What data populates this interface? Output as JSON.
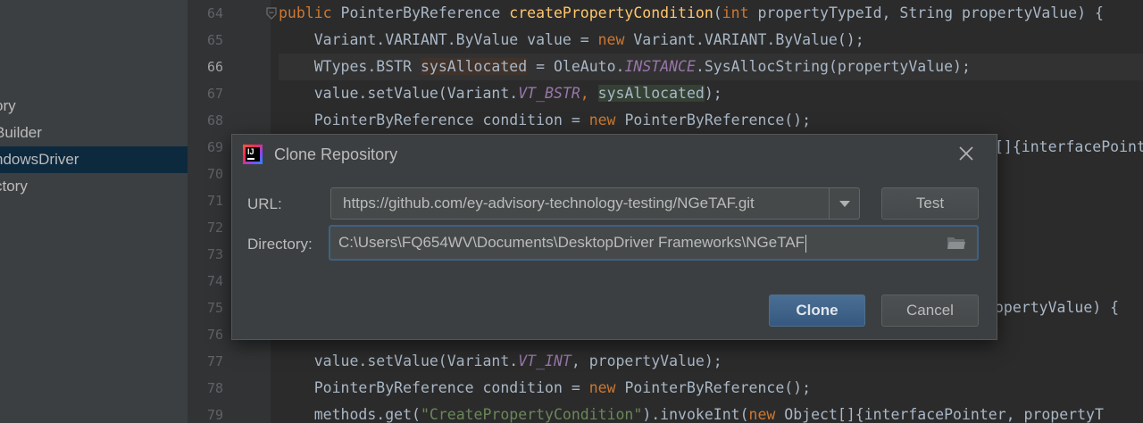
{
  "sidebar": {
    "items": [
      {
        "label": "ory",
        "selected": false
      },
      {
        "label": "Builder",
        "selected": false
      },
      {
        "label": "ndowsDriver",
        "selected": true
      },
      {
        "label": "ctory",
        "selected": false
      }
    ]
  },
  "editor": {
    "line_numbers": [
      "64",
      "65",
      "66",
      "67",
      "68",
      "69",
      "70",
      "71",
      "72",
      "73",
      "74",
      "75",
      "76",
      "77",
      "78",
      "79"
    ],
    "current_line": "66",
    "lines": {
      "l64": {
        "a": "public ",
        "b": "PointerByReference ",
        "c": "createPropertyCondition",
        "d": "(",
        "e": "int ",
        "f": "propertyTypeId, String propertyValue) {"
      },
      "l65": {
        "a": "    Variant.VARIANT.ByValue value = ",
        "b": "new ",
        "c": "Variant.VARIANT.ByValue();"
      },
      "l66": {
        "a": "    WTypes.BSTR ",
        "b": "sysAllocated",
        "c": " = OleAuto.",
        "d": "INSTANCE",
        "e": ".SysAllocString(propertyValue);"
      },
      "l67": {
        "a": "    value.setValue(Variant.",
        "b": "VT_BSTR",
        "c": ", ",
        "d": "sysAllocated",
        "e": ");"
      },
      "l68": {
        "a": "    PointerByReference condition = ",
        "b": "new ",
        "c": "PointerByReference();"
      },
      "l69": {
        "a": "[]{interfacePoint"
      },
      "l75": {
        "a": "opertyValue) {"
      },
      "l77": {
        "a": "    value.setValue(Variant.",
        "b": "VT_INT",
        "c": ", propertyValue);"
      },
      "l78": {
        "a": "    PointerByReference condition = ",
        "b": "new ",
        "c": "PointerByReference();"
      },
      "l79": {
        "a": "    methods.get(",
        "b": "\"CreatePropertyCondition\"",
        "c": ").invokeInt(",
        "d": "new ",
        "e": "Object[]{interfacePointer, propertyT"
      }
    }
  },
  "dialog": {
    "title": "Clone Repository",
    "url_label": "URL:",
    "url_value": "https://github.com/ey-advisory-technology-testing/NGeTAF.git",
    "test_button": "Test",
    "directory_label": "Directory:",
    "directory_value": "C:\\Users\\FQ654WV\\Documents\\DesktopDriver Frameworks\\NGeTAF",
    "clone_button": "Clone",
    "cancel_button": "Cancel",
    "logo_text": "IJ"
  },
  "colors": {
    "editor_bg": "#2b2b2b",
    "sidebar_bg": "#3c3f41",
    "selection": "#0d293e",
    "keyword": "#cc7832",
    "method": "#ffc66d",
    "static_field": "#9876aa",
    "string": "#6a8759",
    "primary_button": "#365880"
  },
  "icons": [
    "close-icon",
    "chevron-down-icon",
    "folder-icon",
    "intellij-logo-icon",
    "fold-marker-icon"
  ]
}
